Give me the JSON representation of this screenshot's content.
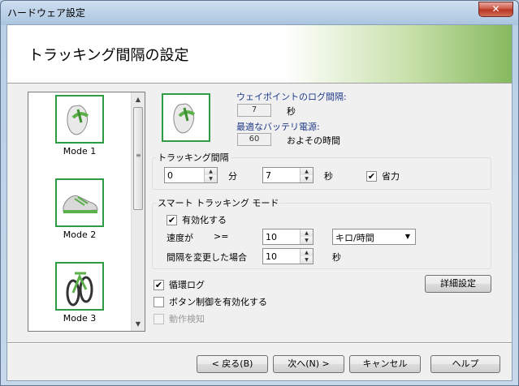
{
  "window": {
    "title": "ハードウェア設定",
    "close_glyph": "✕"
  },
  "header": {
    "title": "トラッキング間隔の設定"
  },
  "modes": [
    {
      "label": "Mode 1",
      "icon": "flip-flop-icon"
    },
    {
      "label": "Mode 2",
      "icon": "sneaker-icon"
    },
    {
      "label": "Mode 3",
      "icon": "bicycle-icon"
    }
  ],
  "info": {
    "waypoint_label": "ウェイポイントのログ間隔:",
    "waypoint_value": "7",
    "waypoint_unit": "秒",
    "battery_label": "最適なバッテリ電源:",
    "battery_value": "60",
    "battery_unit": "およその時間"
  },
  "tracking": {
    "legend": "トラッキング間隔",
    "minutes_value": "0",
    "minutes_unit": "分",
    "seconds_value": "7",
    "seconds_unit": "秒",
    "power_save_label": "省力",
    "power_save_checked": true
  },
  "smart": {
    "legend": "スマート トラッキング モード",
    "enable_label": "有効化する",
    "enable_checked": true,
    "speed_label": "速度が",
    "speed_op": ">=",
    "speed_value": "10",
    "speed_unit_selected": "キロ/時間",
    "interval_label": "間隔を変更した場合",
    "interval_value": "10",
    "interval_unit": "秒"
  },
  "options": {
    "loop_log_label": "循環ログ",
    "loop_log_checked": true,
    "button_control_label": "ボタン制御を有効化する",
    "button_control_checked": false,
    "motion_detect_label": "動作検知",
    "motion_detect_checked": false
  },
  "buttons": {
    "advanced": "詳細設定",
    "back": "< 戻る(B)",
    "next": "次へ(N) >",
    "cancel": "キャンセル",
    "help": "ヘルプ"
  },
  "colors": {
    "accent_green": "#2e9b45",
    "header_gradient_end": "#86b95f",
    "label_blue": "#1f3a8a"
  }
}
